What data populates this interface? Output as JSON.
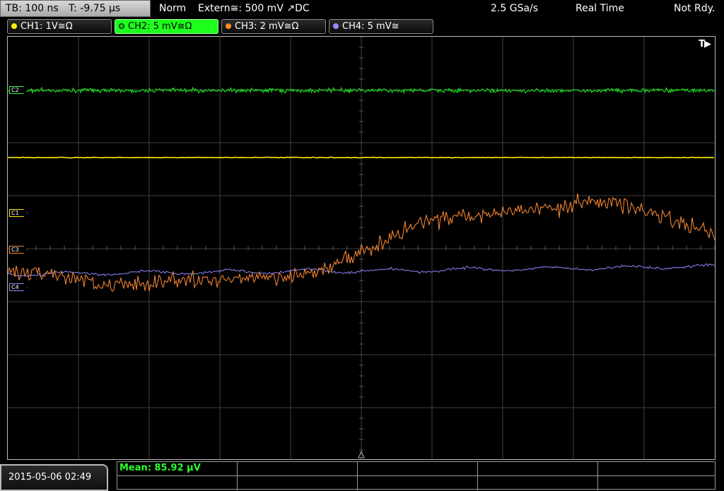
{
  "header": {
    "timebase": "TB: 100 ns",
    "trigger_time": "T: -9.75 µs",
    "acq_mode": "Norm",
    "trigger_source": "Extern≅: 500 mV ↗DC",
    "sample_rate": "2.5 GSa/s",
    "acq_type": "Real Time",
    "status": "Not Rdy."
  },
  "channels": [
    {
      "label": "CH1: 1V≅Ω",
      "color": "#ffef00",
      "active": false
    },
    {
      "label": "CH2: 5 mV≅Ω",
      "color": "#33ff33",
      "active": true
    },
    {
      "label": "CH3: 2 mV≅Ω",
      "color": "#ff8a24",
      "active": false
    },
    {
      "label": "CH4: 5 mV≅",
      "color": "#8f8fff",
      "active": false
    }
  ],
  "markers": {
    "c1": "C1",
    "c2": "C2",
    "c3": "C3",
    "c4": "C4",
    "trigger": "T▶"
  },
  "footer": {
    "datetime": "2015-05-06 02:49",
    "measurement": "Mean: 85.92 µV"
  },
  "colors": {
    "grid": "#404040",
    "ch1": "#ffef00",
    "ch2": "#1fe61f",
    "ch3": "#ef8230",
    "ch4": "#7f7fe6"
  }
}
